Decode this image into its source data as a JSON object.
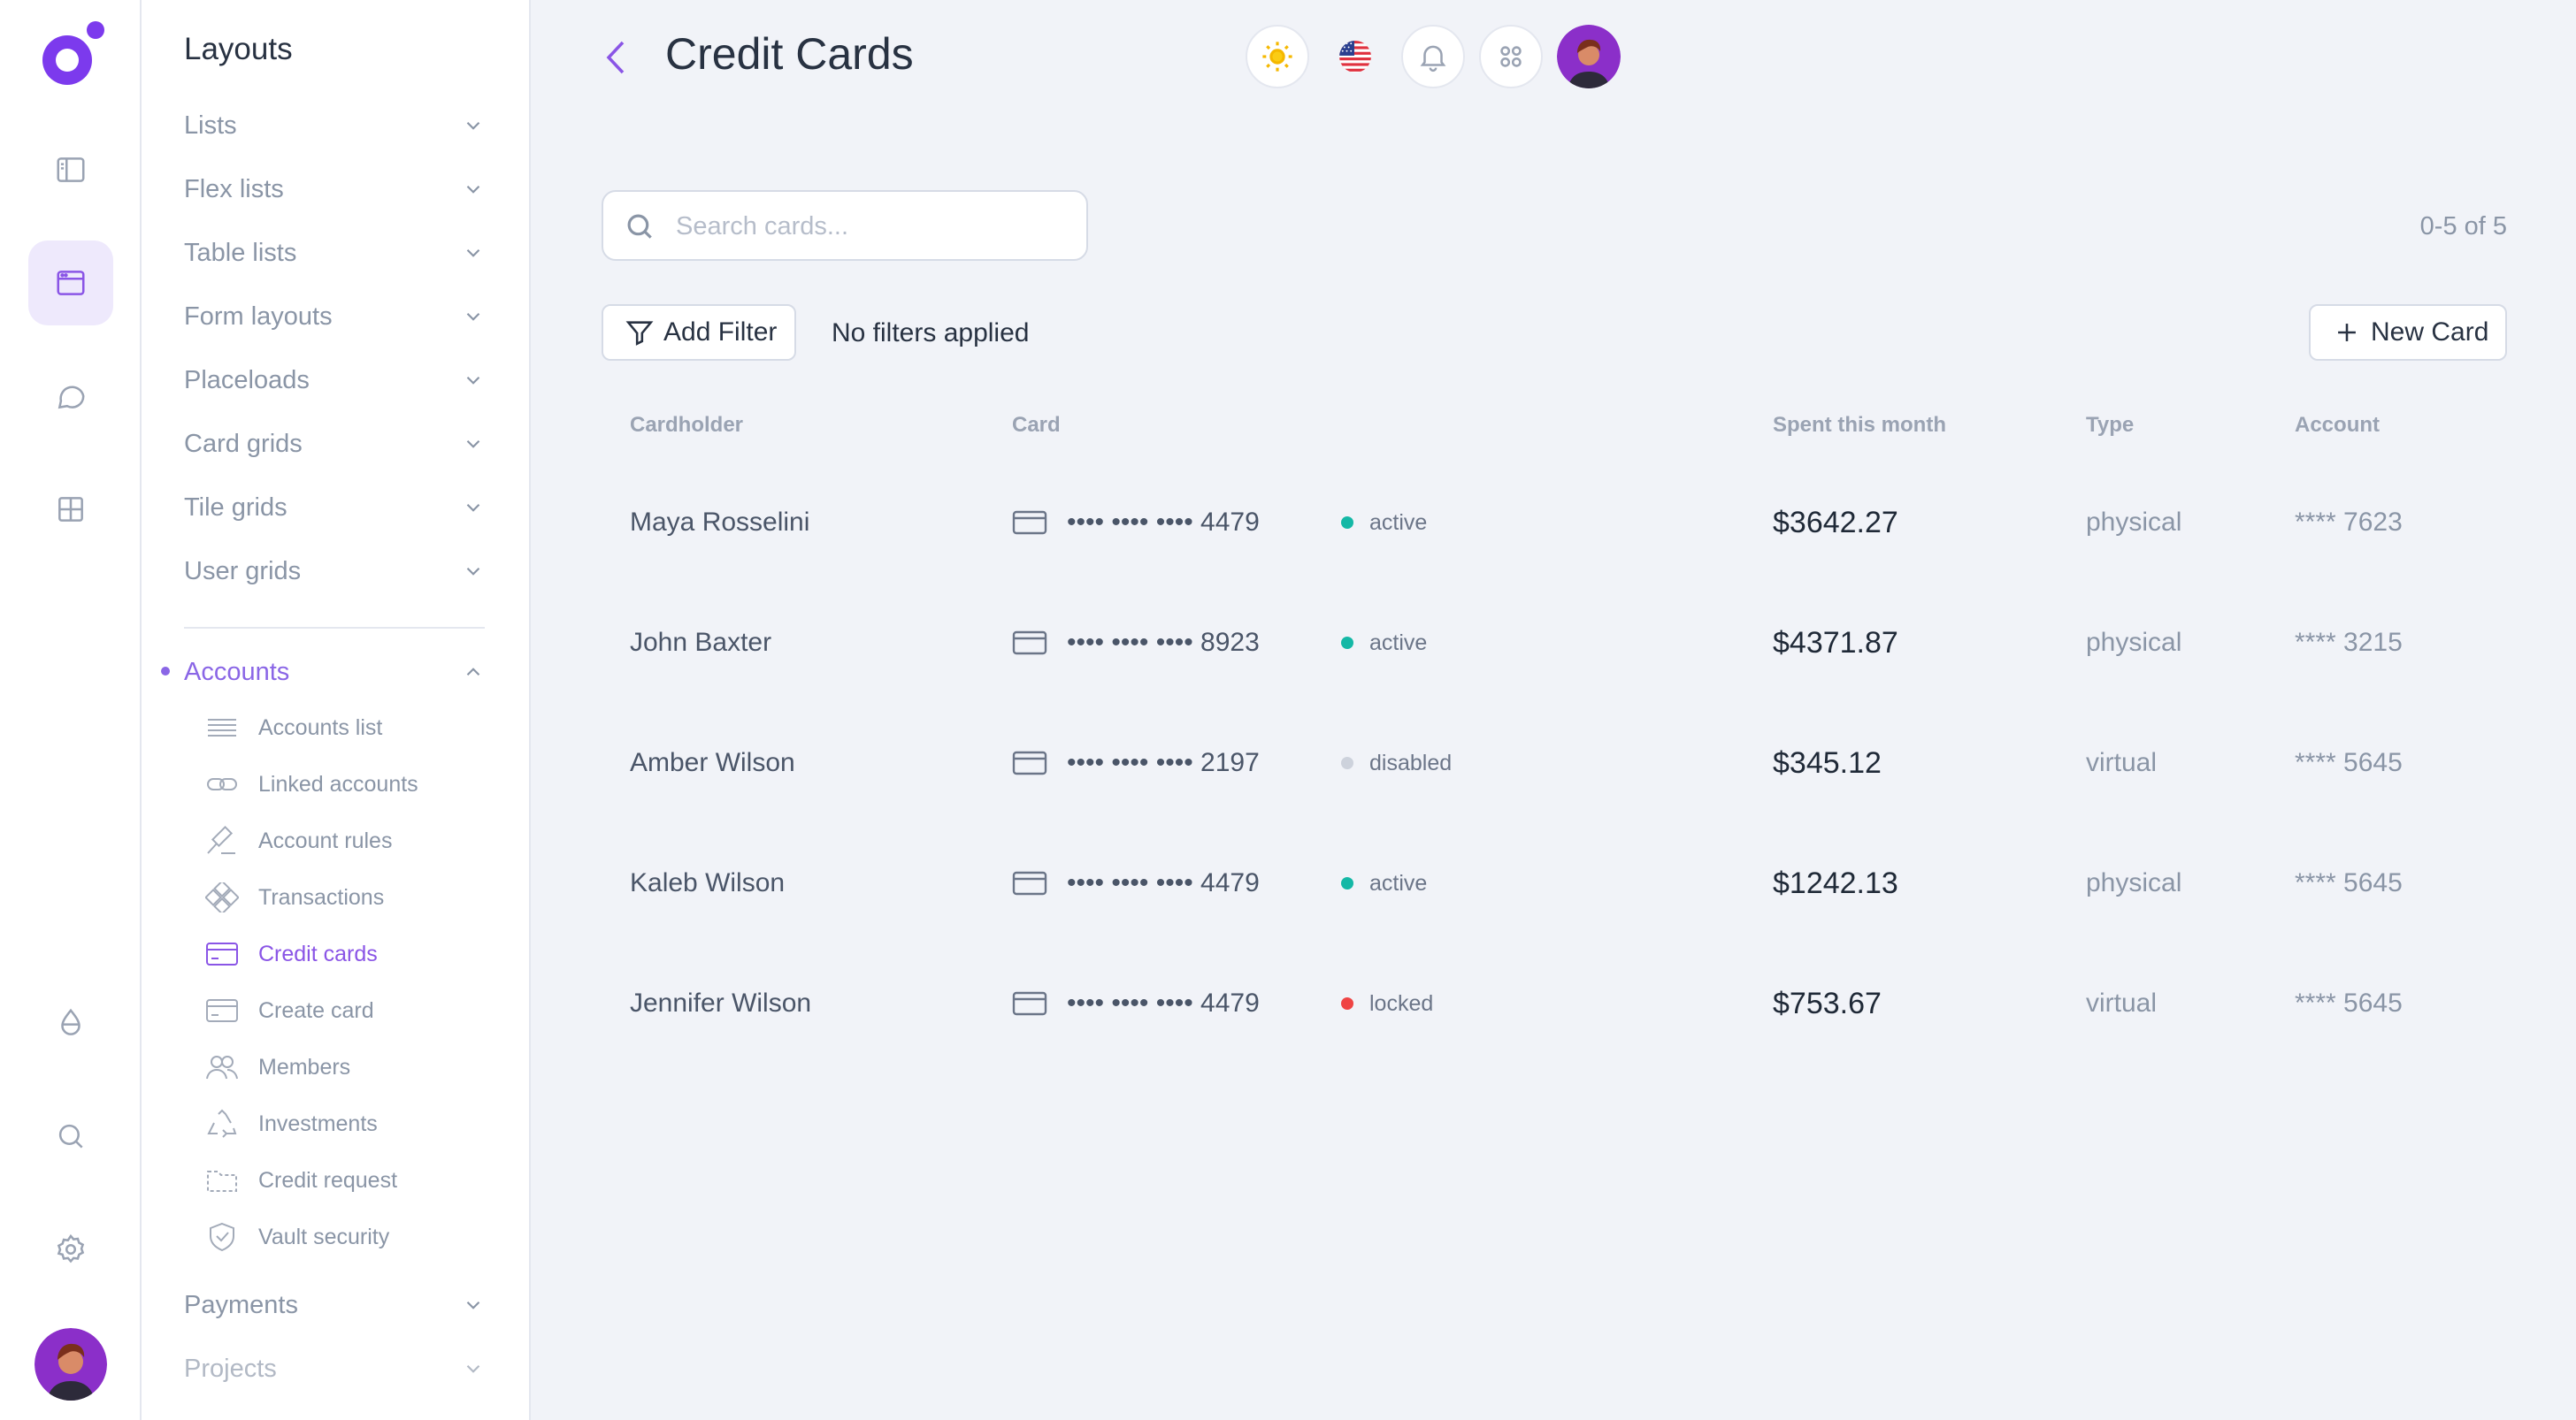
{
  "sidebar": {
    "title": "Layouts",
    "items": [
      {
        "label": "Lists"
      },
      {
        "label": "Flex lists"
      },
      {
        "label": "Table lists"
      },
      {
        "label": "Form layouts"
      },
      {
        "label": "Placeloads"
      },
      {
        "label": "Card grids"
      },
      {
        "label": "Tile grids"
      },
      {
        "label": "User grids"
      }
    ],
    "accounts": {
      "label": "Accounts",
      "subitems": [
        {
          "label": "Accounts list",
          "icon": "list-icon"
        },
        {
          "label": "Linked accounts",
          "icon": "link-icon"
        },
        {
          "label": "Account rules",
          "icon": "gavel-icon"
        },
        {
          "label": "Transactions",
          "icon": "transactions-icon"
        },
        {
          "label": "Credit cards",
          "icon": "credit-card-icon",
          "active": true
        },
        {
          "label": "Create card",
          "icon": "create-card-icon"
        },
        {
          "label": "Members",
          "icon": "members-icon"
        },
        {
          "label": "Investments",
          "icon": "recycle-icon"
        },
        {
          "label": "Credit request",
          "icon": "folder-icon"
        },
        {
          "label": "Vault security",
          "icon": "shield-icon"
        }
      ]
    },
    "bottom_items": [
      {
        "label": "Payments"
      },
      {
        "label": "Projects"
      }
    ]
  },
  "header": {
    "title": "Credit Cards"
  },
  "search": {
    "placeholder": "Search cards..."
  },
  "paging": "0-5 of 5",
  "toolbar": {
    "add_filter": "Add Filter",
    "filter_status": "No filters applied",
    "new_card": "New Card"
  },
  "table": {
    "headers": {
      "cardholder": "Cardholder",
      "card": "Card",
      "spent": "Spent this month",
      "type": "Type",
      "account": "Account"
    },
    "rows": [
      {
        "name": "Maya Rosselini",
        "card": "•••• •••• •••• 4479",
        "status": "active",
        "spent": "$3642.27",
        "type": "physical",
        "account": "**** 7623"
      },
      {
        "name": "John Baxter",
        "card": "•••• •••• •••• 8923",
        "status": "active",
        "spent": "$4371.87",
        "type": "physical",
        "account": "**** 3215"
      },
      {
        "name": "Amber Wilson",
        "card": "•••• •••• •••• 2197",
        "status": "disabled",
        "spent": "$345.12",
        "type": "virtual",
        "account": "**** 5645"
      },
      {
        "name": "Kaleb Wilson",
        "card": "•••• •••• •••• 4479",
        "status": "active",
        "spent": "$1242.13",
        "type": "physical",
        "account": "**** 5645"
      },
      {
        "name": "Jennifer Wilson",
        "card": "•••• •••• •••• 4479",
        "status": "locked",
        "spent": "$753.67",
        "type": "virtual",
        "account": "**** 5645"
      }
    ]
  },
  "colors": {
    "accent": "#8a55e6",
    "active": "#14b8a6",
    "disabled": "#cdd2dc",
    "locked": "#ef4444"
  }
}
